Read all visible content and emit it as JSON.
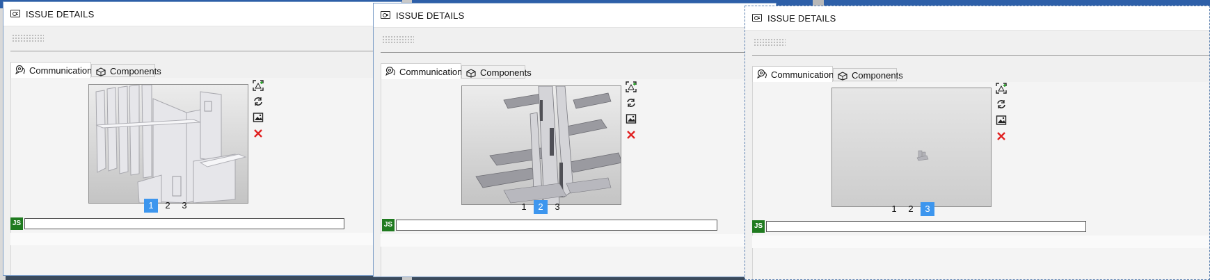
{
  "colors": {
    "accent": "#3d96ee",
    "avatar_bg": "#1f7a1f",
    "delete": "#e02020"
  },
  "windows": [
    {
      "title": "ISSUE DETAILS",
      "tabs": [
        {
          "label": "Communication"
        },
        {
          "label": "Components"
        }
      ],
      "snapshot_pages": [
        "1",
        "2",
        "3"
      ],
      "selected_page": "1",
      "user_initials": "JS",
      "comment_value": ""
    },
    {
      "title": "ISSUE DETAILS",
      "tabs": [
        {
          "label": "Communication"
        },
        {
          "label": "Components"
        }
      ],
      "snapshot_pages": [
        "1",
        "2",
        "3"
      ],
      "selected_page": "2",
      "user_initials": "JS",
      "comment_value": ""
    },
    {
      "title": "ISSUE DETAILS",
      "tabs": [
        {
          "label": "Communication"
        },
        {
          "label": "Components"
        }
      ],
      "snapshot_pages": [
        "1",
        "2",
        "3"
      ],
      "selected_page": "3",
      "user_initials": "JS",
      "comment_value": ""
    }
  ],
  "icons": {
    "title": "issue-card-icon",
    "close": "close-icon",
    "panel": "panel-toggle-icon",
    "tab_communication": "chat-bubbles-icon",
    "tab_components": "component-cube-icon",
    "capture": "capture-view-icon",
    "refresh": "refresh-icon",
    "image": "image-icon",
    "delete": "delete-icon"
  }
}
